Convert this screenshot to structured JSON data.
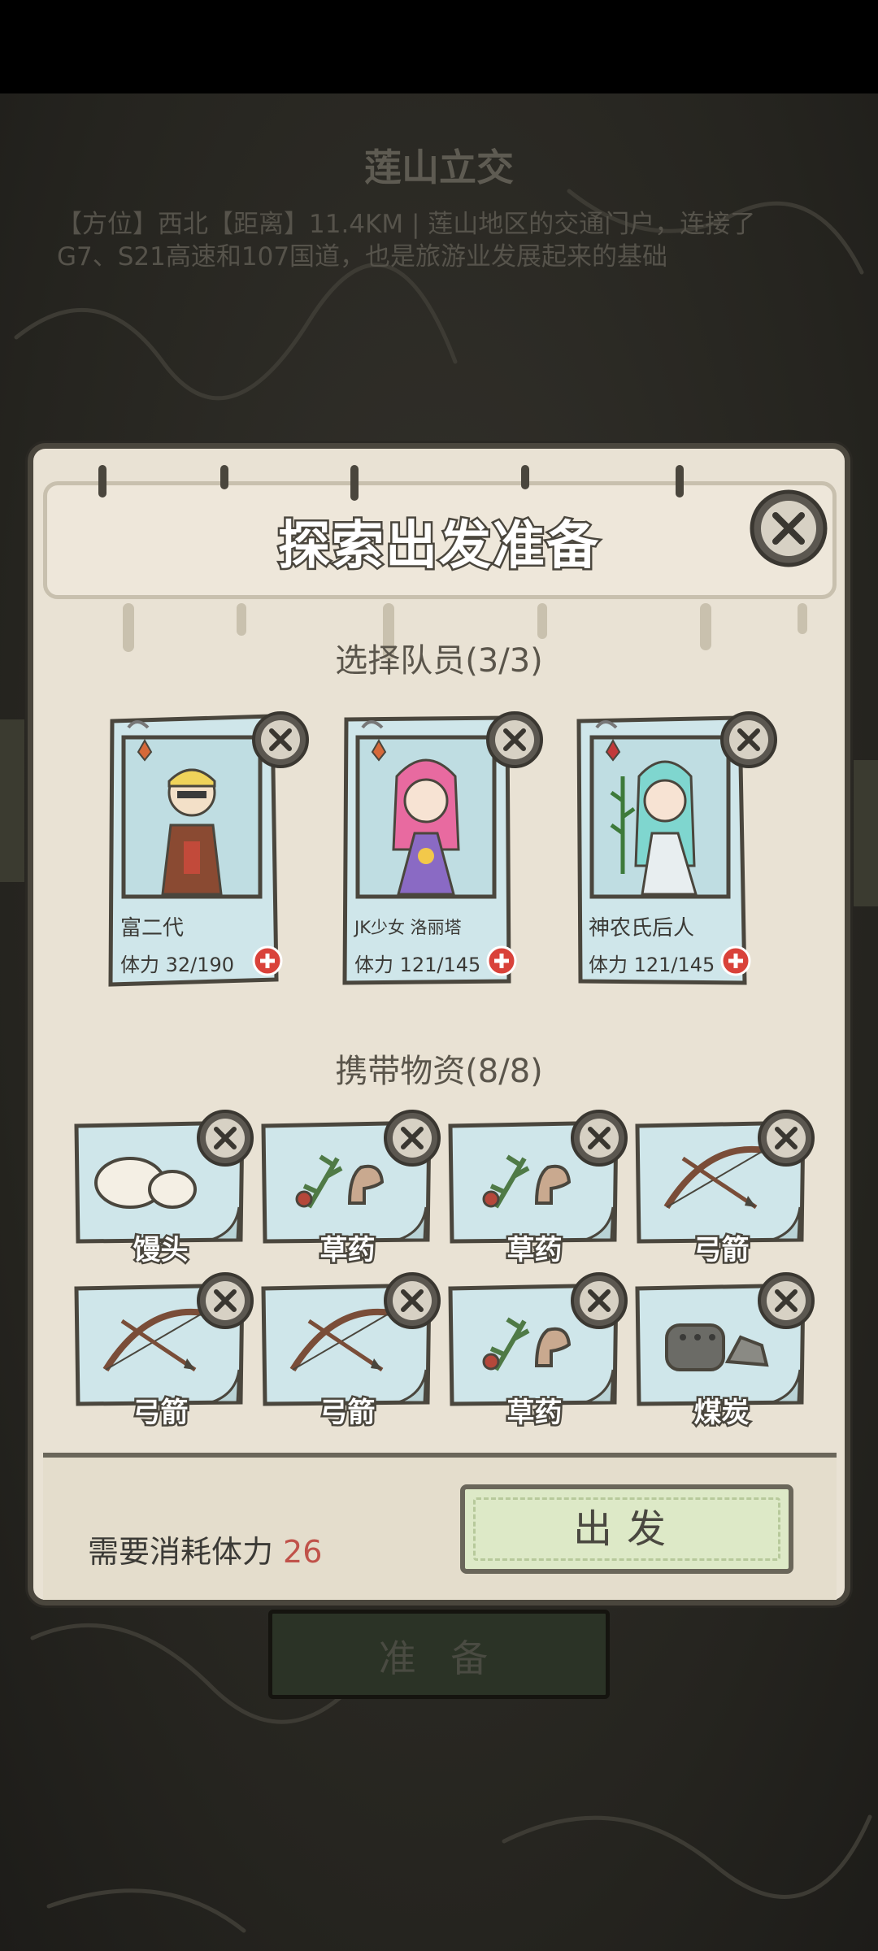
{
  "background": {
    "location_title": "莲山立交",
    "location_desc": "【方位】西北【距离】11.4KM | 莲山地区的交通门户，连接了G7、S21高速和107国道，也是旅游业发展起来的基础",
    "prepare_button": "准 备"
  },
  "dialog": {
    "title": "探索出发准备",
    "team_section": "选择队员(3/3)",
    "items_section": "携带物资(8/8)",
    "members": [
      {
        "name": "富二代",
        "stamina": "体力 32/190"
      },
      {
        "name": "JK少女 洛丽塔",
        "stamina": "体力 121/145"
      },
      {
        "name": "神农氏后人",
        "stamina": "体力 121/145"
      }
    ],
    "items": [
      {
        "label": "馒头",
        "icon": "steamed-bun-icon"
      },
      {
        "label": "草药",
        "icon": "herb-icon"
      },
      {
        "label": "草药",
        "icon": "herb-icon"
      },
      {
        "label": "弓箭",
        "icon": "bow-arrow-icon"
      },
      {
        "label": "弓箭",
        "icon": "bow-arrow-icon"
      },
      {
        "label": "弓箭",
        "icon": "bow-arrow-icon"
      },
      {
        "label": "草药",
        "icon": "herb-icon"
      },
      {
        "label": "煤炭",
        "icon": "coal-icon"
      }
    ],
    "cost_label": "需要消耗体力",
    "cost_value": "26",
    "go_button": "出发"
  },
  "colors": {
    "accent_red": "#c0524a",
    "paper_blue": "#cfe6ea",
    "go_green": "#dde9c7",
    "outline": "#4a463d"
  }
}
